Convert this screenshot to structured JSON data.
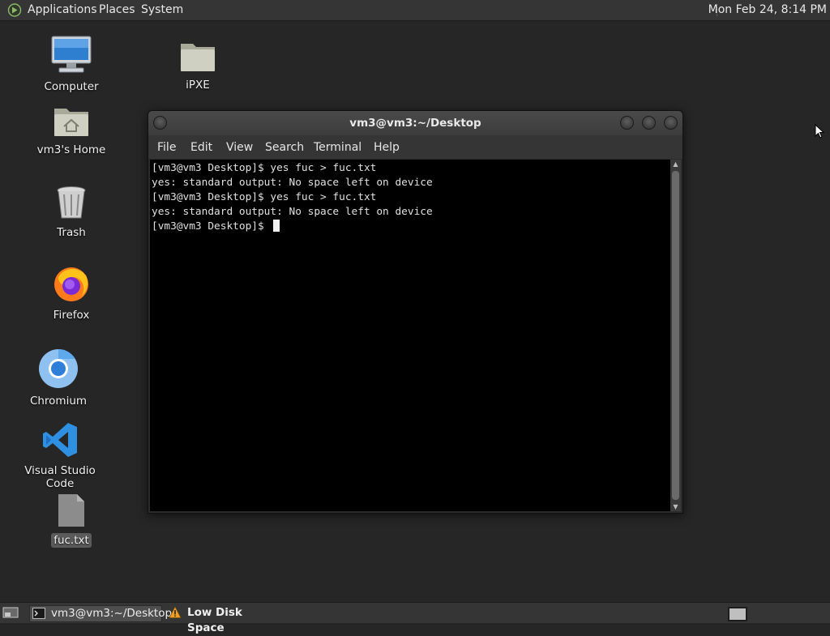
{
  "top_panel": {
    "menus": [
      "Applications",
      "Places",
      "System"
    ],
    "clock": "Mon Feb 24,  8:14 PM"
  },
  "desktop_icons": [
    {
      "label": "Computer",
      "icon": "computer-icon"
    },
    {
      "label": "iPXE",
      "icon": "folder-icon"
    },
    {
      "label": "vm3's Home",
      "icon": "home-folder-icon"
    },
    {
      "label": "Trash",
      "icon": "trash-icon"
    },
    {
      "label": "Firefox",
      "icon": "firefox-icon"
    },
    {
      "label": "Chromium",
      "icon": "chromium-icon"
    },
    {
      "label": "Visual Studio Code",
      "icon": "vscode-icon"
    },
    {
      "label": "fuc.txt",
      "icon": "text-file-icon"
    }
  ],
  "terminal": {
    "title": "vm3@vm3:~/Desktop",
    "menu": [
      "File",
      "Edit",
      "View",
      "Search",
      "Terminal",
      "Help"
    ],
    "lines": [
      "[vm3@vm3 Desktop]$ yes fuc > fuc.txt",
      "yes: standard output: No space left on device",
      "[vm3@vm3 Desktop]$ yes fuc > fuc.txt",
      "yes: standard output: No space left on device",
      "[vm3@vm3 Desktop]$ "
    ]
  },
  "bottom_panel": {
    "tasks": [
      {
        "label": "vm3@vm3:~/Desktop",
        "icon": "terminal-icon"
      },
      {
        "label": "Low Disk Space",
        "icon": "warning-icon"
      }
    ]
  },
  "colors": {
    "desktop_bg": "#262626",
    "panel_bg": "#353535",
    "terminal_bg": "#000000",
    "warning": "#f0a020",
    "vscode_blue": "#2f8fe0",
    "chromium_blue": "#2f7fd8"
  }
}
